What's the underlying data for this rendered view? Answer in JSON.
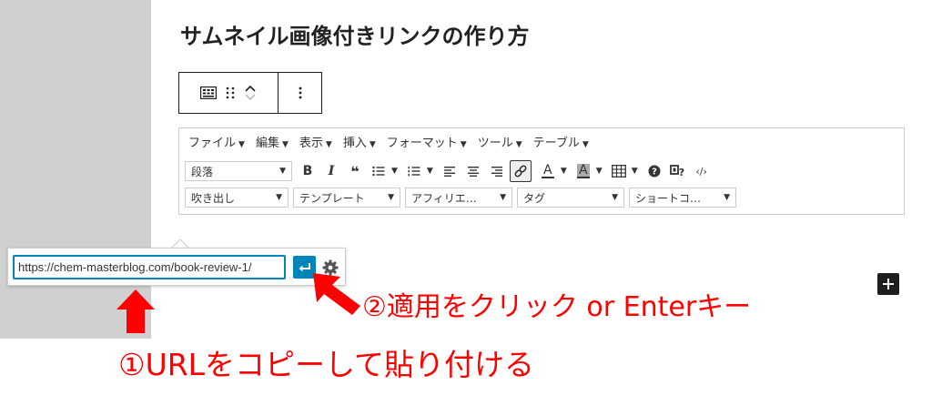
{
  "title": "サムネイル画像付きリンクの作り方",
  "menubar": [
    {
      "label": "ファイル"
    },
    {
      "label": "編集"
    },
    {
      "label": "表示"
    },
    {
      "label": "挿入"
    },
    {
      "label": "フォーマット"
    },
    {
      "label": "ツール"
    },
    {
      "label": "テーブル"
    }
  ],
  "selects": {
    "paragraph": "段落",
    "balloon": "吹き出し",
    "template": "テンプレート",
    "affiliate": "アフィリエ…",
    "tag": "タグ",
    "shortcode": "ショートコ…"
  },
  "toolbar_glyphs": {
    "bold": "B",
    "italic": "I",
    "quote": "❝",
    "text_color": "A",
    "bg_color": "A",
    "code": "‹/›"
  },
  "link_popover": {
    "url": "https://chem-masterblog.com/book-review-1/"
  },
  "annotations": {
    "step1": "①URLをコピーして貼り付ける",
    "step2": "②適用をクリック or Enterキー"
  },
  "colors": {
    "accent": "#0085ba",
    "annotation": "#ff0000",
    "sidebar": "#d0d0d0"
  }
}
